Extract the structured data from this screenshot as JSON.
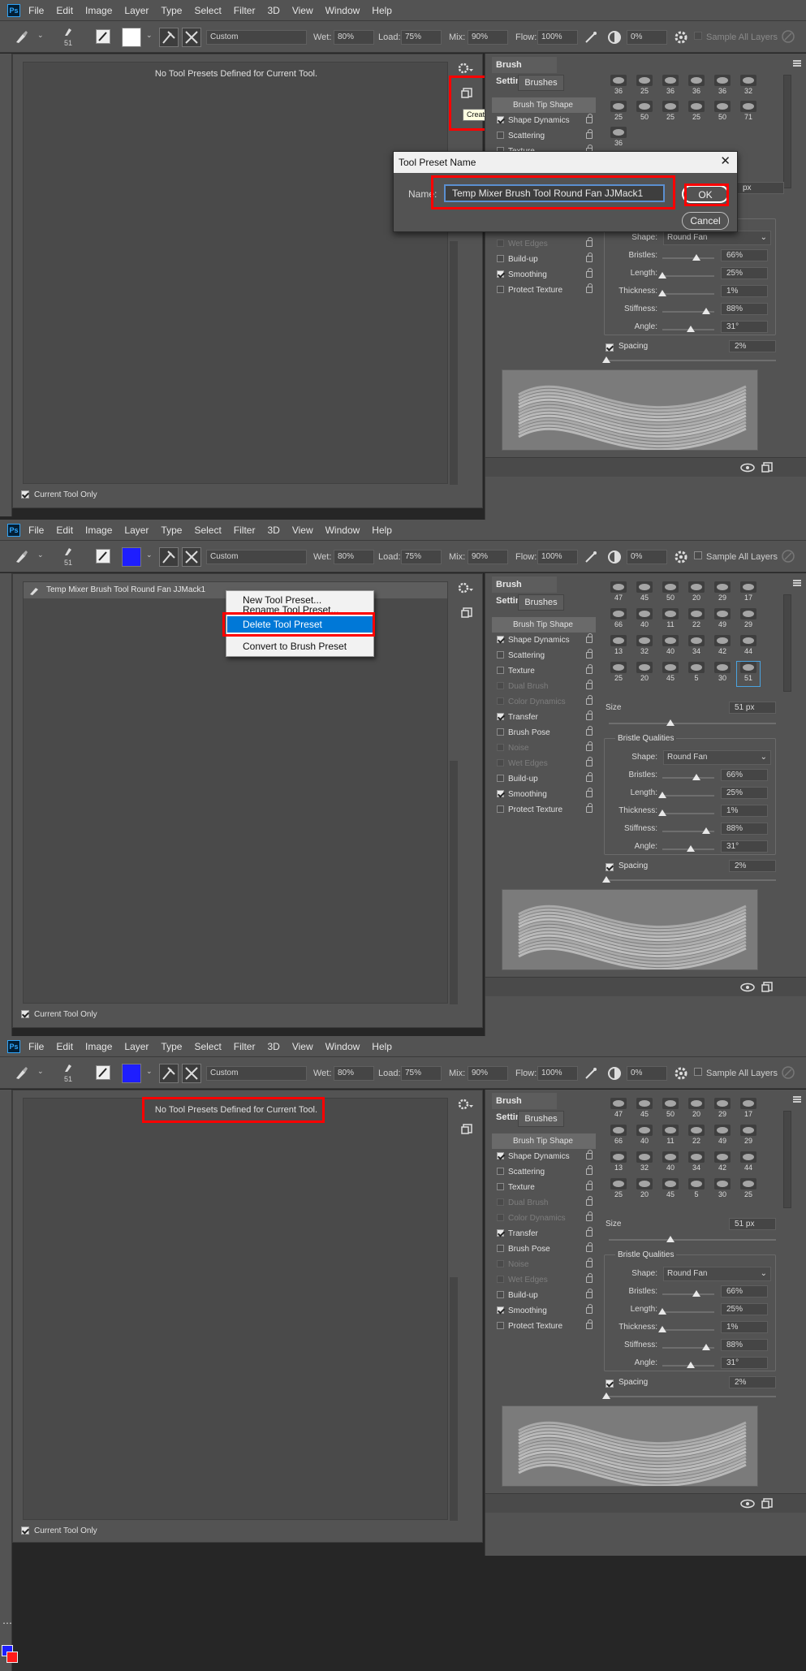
{
  "app": {
    "logo": "Ps"
  },
  "menu": [
    "File",
    "Edit",
    "Image",
    "Layer",
    "Type",
    "Select",
    "Filter",
    "3D",
    "View",
    "Window",
    "Help"
  ],
  "options": {
    "brush_size": "51",
    "preset_select": "Custom",
    "wet_label": "Wet:",
    "wet": "80%",
    "load_label": "Load:",
    "load": "75%",
    "mix_label": "Mix:",
    "mix": "90%",
    "flow_label": "Flow:",
    "flow": "100%",
    "angle": "0%",
    "sample_all": "Sample All Layers",
    "swatch_colors": [
      "#ffffff",
      "#1e1eff",
      "#1e1eff"
    ]
  },
  "tool_presets": {
    "empty_message": "No Tool Presets Defined for Current Tool.",
    "current_tool_only": "Current Tool Only",
    "preset_item": "Temp Mixer Brush Tool Round Fan JJMack1",
    "create_tooltip": "Create new tool preset"
  },
  "dialog": {
    "title": "Tool Preset Name",
    "name_label": "Name:",
    "name_value": "Temp Mixer Brush Tool Round Fan JJMack1",
    "ok": "OK",
    "cancel": "Cancel"
  },
  "context_menu": [
    "New Tool Preset...",
    "Rename Tool Preset...",
    "Delete Tool Preset",
    "Convert to Brush Preset"
  ],
  "brush_settings": {
    "tab": "Brush Settings",
    "brushes_button": "Brushes",
    "tip_shape": "Brush Tip Shape",
    "options": [
      {
        "label": "Shape Dynamics",
        "checked": true,
        "enabled": true
      },
      {
        "label": "Scattering",
        "checked": false,
        "enabled": true
      },
      {
        "label": "Texture",
        "checked": false,
        "enabled": true
      },
      {
        "label": "Dual Brush",
        "checked": false,
        "enabled": false
      },
      {
        "label": "Color Dynamics",
        "checked": false,
        "enabled": false
      },
      {
        "label": "Transfer",
        "checked": true,
        "enabled": true
      },
      {
        "label": "Brush Pose",
        "checked": false,
        "enabled": true
      },
      {
        "label": "Noise",
        "checked": false,
        "enabled": false
      },
      {
        "label": "Wet Edges",
        "checked": false,
        "enabled": false
      },
      {
        "label": "Build-up",
        "checked": false,
        "enabled": true
      },
      {
        "label": "Smoothing",
        "checked": true,
        "enabled": true
      },
      {
        "label": "Protect Texture",
        "checked": false,
        "enabled": true
      }
    ],
    "grid_top": [
      "36",
      "25",
      "36",
      "36",
      "36",
      "32",
      "25",
      "50",
      "25",
      "25",
      "50",
      "71",
      "36"
    ],
    "grid_rows": [
      [
        "47",
        "45",
        "50",
        "20",
        "29",
        "17"
      ],
      [
        "66",
        "40",
        "11",
        "22",
        "49",
        "29"
      ],
      [
        "13",
        "32",
        "40",
        "34",
        "42",
        "44"
      ]
    ],
    "grid_last_row": [
      "25",
      "20",
      "45",
      "5",
      "30",
      "51"
    ],
    "grid_last_row_after": [
      "25",
      "20",
      "45",
      "5",
      "30",
      "25"
    ],
    "size_label": "Size",
    "size": "51 px",
    "size_partial": "px",
    "bristle_title": "Bristle Qualities",
    "shape_label": "Shape:",
    "shape": "Round Fan",
    "sliders": [
      {
        "label": "Bristles:",
        "value": "66%",
        "pos": 0.66
      },
      {
        "label": "Length:",
        "value": "25%",
        "pos": 0.0
      },
      {
        "label": "Thickness:",
        "value": "1%",
        "pos": 0.0
      },
      {
        "label": "Stiffness:",
        "value": "88%",
        "pos": 0.85
      },
      {
        "label": "Angle:",
        "value": "31°",
        "pos": 0.55
      }
    ],
    "spacing_label": "Spacing",
    "spacing": "2%"
  }
}
